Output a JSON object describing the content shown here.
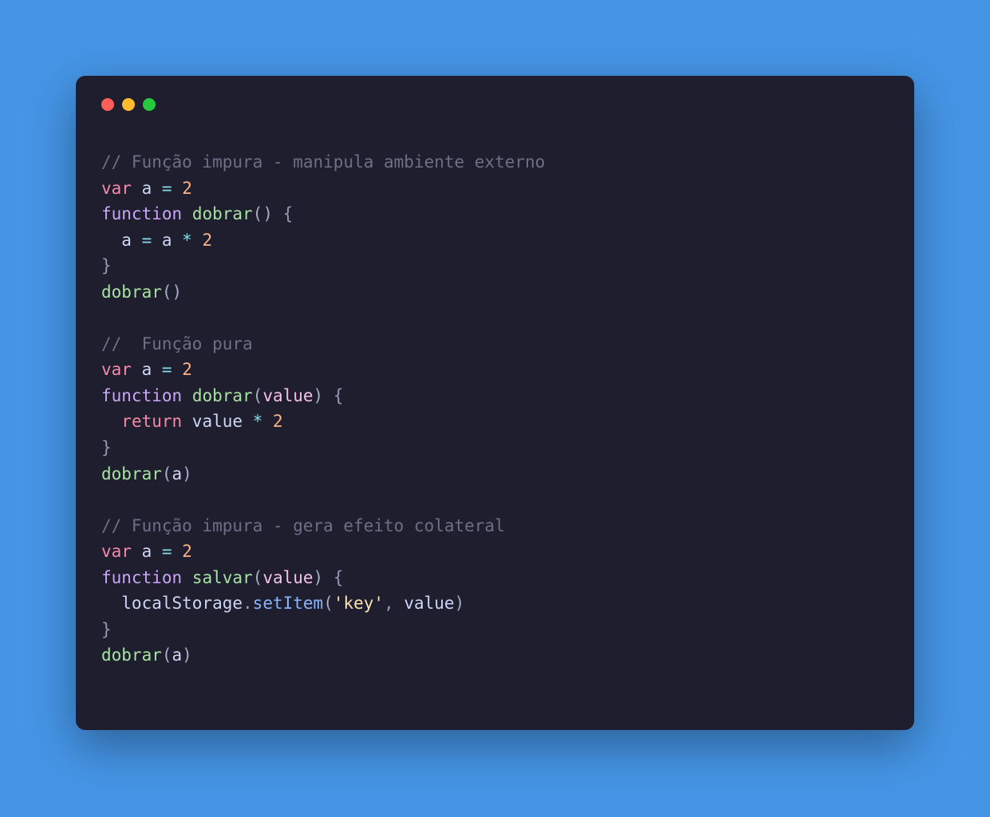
{
  "colors": {
    "background": "#4595e6",
    "window": "#1e1e2e",
    "traffic_red": "#ff5f56",
    "traffic_yellow": "#ffbd2e",
    "traffic_green": "#27c93f"
  },
  "code": {
    "lines": [
      [
        {
          "t": "comment",
          "v": "// Função impura - manipula ambiente externo"
        }
      ],
      [
        {
          "t": "var",
          "v": "var"
        },
        {
          "t": "ident",
          "v": " a "
        },
        {
          "t": "op",
          "v": "="
        },
        {
          "t": "ident",
          "v": " "
        },
        {
          "t": "number",
          "v": "2"
        }
      ],
      [
        {
          "t": "keyword",
          "v": "function"
        },
        {
          "t": "ident",
          "v": " "
        },
        {
          "t": "func",
          "v": "dobrar"
        },
        {
          "t": "paren",
          "v": "()"
        },
        {
          "t": "ident",
          "v": " "
        },
        {
          "t": "punc",
          "v": "{"
        }
      ],
      [
        {
          "t": "ident",
          "v": "  a "
        },
        {
          "t": "op",
          "v": "="
        },
        {
          "t": "ident",
          "v": " a "
        },
        {
          "t": "op",
          "v": "*"
        },
        {
          "t": "ident",
          "v": " "
        },
        {
          "t": "number",
          "v": "2"
        }
      ],
      [
        {
          "t": "punc",
          "v": "}"
        }
      ],
      [
        {
          "t": "func",
          "v": "dobrar"
        },
        {
          "t": "paren",
          "v": "()"
        }
      ],
      [],
      [
        {
          "t": "comment",
          "v": "//  Função pura"
        }
      ],
      [
        {
          "t": "var",
          "v": "var"
        },
        {
          "t": "ident",
          "v": " a "
        },
        {
          "t": "op",
          "v": "="
        },
        {
          "t": "ident",
          "v": " "
        },
        {
          "t": "number",
          "v": "2"
        }
      ],
      [
        {
          "t": "keyword",
          "v": "function"
        },
        {
          "t": "ident",
          "v": " "
        },
        {
          "t": "func",
          "v": "dobrar"
        },
        {
          "t": "paren",
          "v": "("
        },
        {
          "t": "param",
          "v": "value"
        },
        {
          "t": "paren",
          "v": ")"
        },
        {
          "t": "ident",
          "v": " "
        },
        {
          "t": "punc",
          "v": "{"
        }
      ],
      [
        {
          "t": "ident",
          "v": "  "
        },
        {
          "t": "var",
          "v": "return"
        },
        {
          "t": "ident",
          "v": " value "
        },
        {
          "t": "op",
          "v": "*"
        },
        {
          "t": "ident",
          "v": " "
        },
        {
          "t": "number",
          "v": "2"
        }
      ],
      [
        {
          "t": "punc",
          "v": "}"
        }
      ],
      [
        {
          "t": "func",
          "v": "dobrar"
        },
        {
          "t": "paren",
          "v": "("
        },
        {
          "t": "ident",
          "v": "a"
        },
        {
          "t": "paren",
          "v": ")"
        }
      ],
      [],
      [
        {
          "t": "comment",
          "v": "// Função impura - gera efeito colateral"
        }
      ],
      [
        {
          "t": "var",
          "v": "var"
        },
        {
          "t": "ident",
          "v": " a "
        },
        {
          "t": "op",
          "v": "="
        },
        {
          "t": "ident",
          "v": " "
        },
        {
          "t": "number",
          "v": "2"
        }
      ],
      [
        {
          "t": "keyword",
          "v": "function"
        },
        {
          "t": "ident",
          "v": " "
        },
        {
          "t": "func",
          "v": "salvar"
        },
        {
          "t": "paren",
          "v": "("
        },
        {
          "t": "param",
          "v": "value"
        },
        {
          "t": "paren",
          "v": ")"
        },
        {
          "t": "ident",
          "v": " "
        },
        {
          "t": "punc",
          "v": "{"
        }
      ],
      [
        {
          "t": "ident",
          "v": "  localStorage"
        },
        {
          "t": "punc",
          "v": "."
        },
        {
          "t": "method",
          "v": "setItem"
        },
        {
          "t": "paren",
          "v": "("
        },
        {
          "t": "string",
          "v": "'key'"
        },
        {
          "t": "punc",
          "v": ","
        },
        {
          "t": "ident",
          "v": " value"
        },
        {
          "t": "paren",
          "v": ")"
        }
      ],
      [
        {
          "t": "punc",
          "v": "}"
        }
      ],
      [
        {
          "t": "func",
          "v": "dobrar"
        },
        {
          "t": "paren",
          "v": "("
        },
        {
          "t": "ident",
          "v": "a"
        },
        {
          "t": "paren",
          "v": ")"
        }
      ]
    ]
  }
}
